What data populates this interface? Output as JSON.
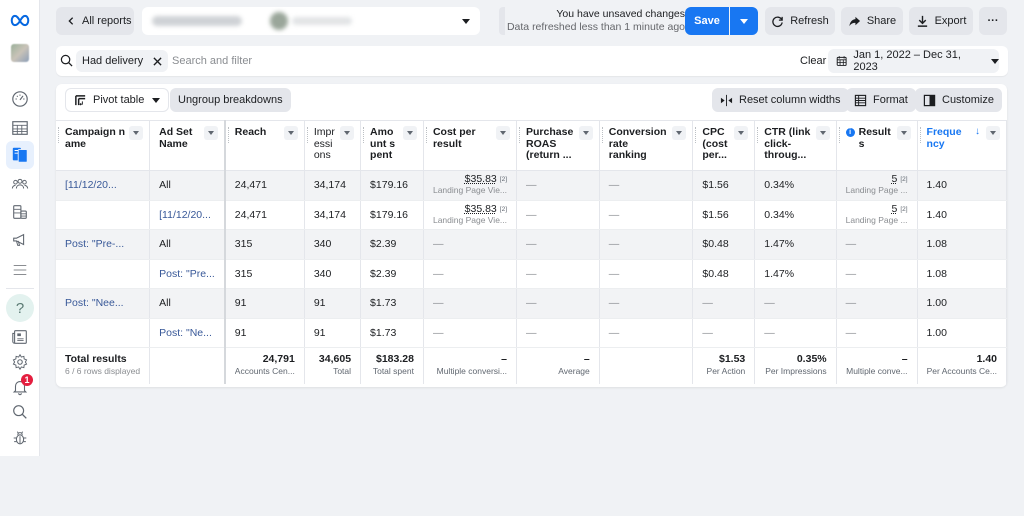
{
  "sidebar": {
    "items": [
      {
        "name": "meta-logo",
        "icon": "meta-logo"
      },
      {
        "name": "account-avatar",
        "icon": "avatar"
      },
      {
        "name": "dashboard",
        "icon": "gauge-icon"
      },
      {
        "name": "ads-reporting-table",
        "icon": "table-icon"
      },
      {
        "name": "reports",
        "icon": "reports-icon",
        "active": true
      },
      {
        "name": "audiences",
        "icon": "people-icon"
      },
      {
        "name": "billing",
        "icon": "coins-icon"
      },
      {
        "name": "campaigns",
        "icon": "megaphone-icon"
      },
      {
        "name": "all-tools",
        "icon": "menu-icon"
      },
      {
        "name": "help",
        "icon": "help-icon",
        "label": "?"
      },
      {
        "name": "news",
        "icon": "news-icon"
      },
      {
        "name": "settings",
        "icon": "gear-icon"
      },
      {
        "name": "notifications",
        "icon": "bell-icon",
        "badge": "1"
      },
      {
        "name": "search",
        "icon": "search-icon"
      },
      {
        "name": "report-bug",
        "icon": "bug-icon"
      }
    ]
  },
  "topbar": {
    "back_label": "All reports",
    "unsaved_line1": "You have unsaved changes",
    "unsaved_line2": "Data refreshed less than 1 minute ago",
    "save_label": "Save",
    "refresh_label": "Refresh",
    "share_label": "Share",
    "export_label": "Export",
    "more_label": "···"
  },
  "filterbar": {
    "chip_label": "Had delivery",
    "search_placeholder": "Search and filter",
    "clear_label": "Clear",
    "date_range": "Jan 1, 2022 – Dec 31, 2023"
  },
  "toolbar": {
    "pivot_label": "Pivot table",
    "ungroup_label": "Ungroup breakdowns",
    "reset_label": "Reset column widths",
    "format_label": "Format",
    "customize_label": "Customize"
  },
  "table": {
    "columns": [
      "Campaign name",
      "Ad Set Name",
      "Reach",
      "Impressions",
      "Amount spent",
      "Cost per result",
      "Purchase ROAS (return ...",
      "Conversion rate ranking",
      "CPC (cost per...",
      "CTR (link click-throug...",
      "Results",
      "Frequency"
    ],
    "rows": [
      {
        "campaign": "[11/12/20...",
        "adset": "All",
        "reach": "24,471",
        "impressions": "34,174",
        "spent": "$179.16",
        "cpr": "$35.83",
        "cpr_note": "[2]",
        "cpr_sub": "Landing Page Vie...",
        "roas": "—",
        "conv_rank": "—",
        "cpc": "$1.56",
        "ctr": "0.34%",
        "results": "5",
        "results_note": "[2]",
        "results_sub": "Landing Page ...",
        "frequency": "1.40"
      },
      {
        "campaign": "",
        "adset": "[11/12/20...",
        "reach": "24,471",
        "impressions": "34,174",
        "spent": "$179.16",
        "cpr": "$35.83",
        "cpr_note": "[2]",
        "cpr_sub": "Landing Page Vie...",
        "roas": "—",
        "conv_rank": "—",
        "cpc": "$1.56",
        "ctr": "0.34%",
        "results": "5",
        "results_note": "[2]",
        "results_sub": "Landing Page ...",
        "frequency": "1.40"
      },
      {
        "campaign": "Post: \"Pre-...",
        "adset": "All",
        "reach": "315",
        "impressions": "340",
        "spent": "$2.39",
        "cpr": "—",
        "roas": "—",
        "conv_rank": "—",
        "cpc": "$0.48",
        "ctr": "1.47%",
        "results": "—",
        "frequency": "1.08"
      },
      {
        "campaign": "",
        "adset": "Post: \"Pre...",
        "reach": "315",
        "impressions": "340",
        "spent": "$2.39",
        "cpr": "—",
        "roas": "—",
        "conv_rank": "—",
        "cpc": "$0.48",
        "ctr": "1.47%",
        "results": "—",
        "frequency": "1.08"
      },
      {
        "campaign": "Post: \"Nee...",
        "adset": "All",
        "reach": "91",
        "impressions": "91",
        "spent": "$1.73",
        "cpr": "—",
        "roas": "—",
        "conv_rank": "—",
        "cpc": "—",
        "ctr": "—",
        "results": "—",
        "frequency": "1.00"
      },
      {
        "campaign": "",
        "adset": "Post: \"Ne...",
        "reach": "91",
        "impressions": "91",
        "spent": "$1.73",
        "cpr": "—",
        "roas": "—",
        "conv_rank": "—",
        "cpc": "—",
        "ctr": "—",
        "results": "—",
        "frequency": "1.00"
      }
    ],
    "totals": {
      "label": "Total results",
      "rows_shown": "6 / 6 rows displayed",
      "reach": "24,791",
      "reach_sub": "Accounts Cen...",
      "impressions": "34,605",
      "impressions_sub": "Total",
      "spent": "$183.28",
      "spent_sub": "Total spent",
      "cpr": "–",
      "cpr_sub": "Multiple conversi...",
      "roas": "–",
      "roas_sub": "Average",
      "cpc": "$1.53",
      "cpc_sub": "Per Action",
      "ctr": "0.35%",
      "ctr_sub": "Per Impressions",
      "results": "–",
      "results_sub": "Multiple conve...",
      "frequency": "1.40",
      "frequency_sub": "Per Accounts Ce..."
    }
  },
  "colors": {
    "accent": "#1877f2",
    "link": "#385898",
    "badge": "#e41e3f"
  }
}
